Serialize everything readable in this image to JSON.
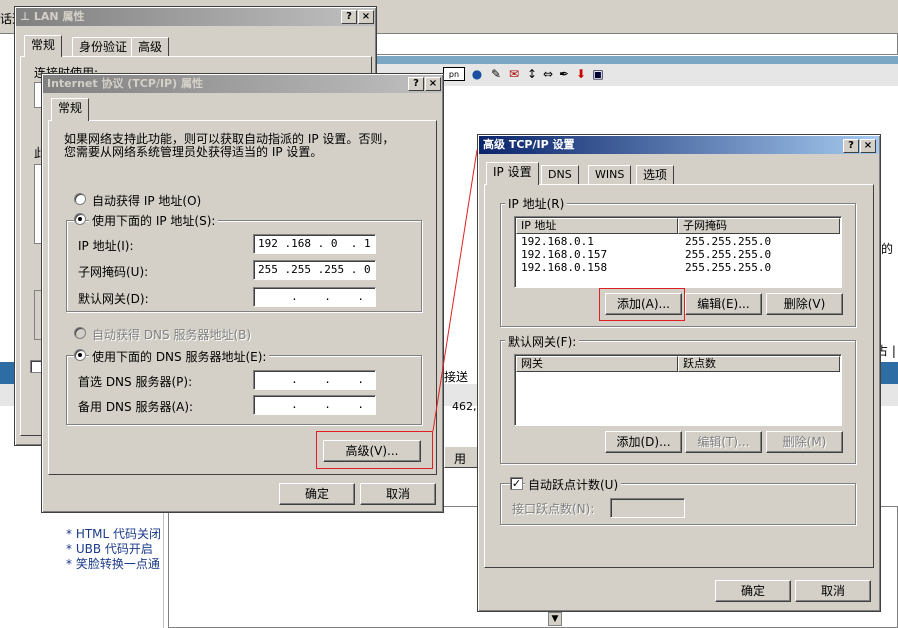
{
  "background": {
    "addr_fragment": "话追",
    "right_tail_text": "的",
    "right_tail_text2": "占 |",
    "sent_label": "接送",
    "sent_value": "462,",
    "apply_fragment": "用",
    "forum_notes": [
      "* HTML 代码关闭",
      "* UBB  代码开启",
      "* 笑脸转换一点通"
    ]
  },
  "lan_window": {
    "title": "LAN 属性",
    "help_btn": "?",
    "close_btn": "×",
    "tabs": [
      "常规",
      "身份验证",
      "高级"
    ],
    "connect_using": "连接时使用:",
    "this_conn": "此"
  },
  "tcpip_window": {
    "title": "Internet 协议 (TCP/IP) 属性",
    "help_btn": "?",
    "close_btn": "×",
    "tab": "常规",
    "desc_line1": "如果网络支持此功能，则可以获取自动指派的 IP 设置。否则，",
    "desc_line2": "您需要从网络系统管理员处获得适当的 IP 设置。",
    "auto_ip": "自动获得 IP 地址(O)",
    "use_ip": "使用下面的 IP 地址(S):",
    "ip_label": "IP 地址(I):",
    "ip_value": "192 .168 . 0  . 1",
    "mask_label": "子网掩码(U):",
    "mask_value": "255 .255 .255 . 0",
    "gateway_label": "默认网关(D):",
    "gateway_value": "     .    .    .",
    "auto_dns": "自动获得 DNS 服务器地址(B)",
    "use_dns": "使用下面的 DNS 服务器地址(E):",
    "pref_dns_label": "首选 DNS 服务器(P):",
    "pref_dns_value": "     .    .    .",
    "alt_dns_label": "备用 DNS 服务器(A):",
    "alt_dns_value": "     .    .    .",
    "advanced_btn": "高级(V)...",
    "ok_btn": "确定",
    "cancel_btn": "取消"
  },
  "advanced_window": {
    "title": "高级 TCP/IP 设置",
    "help_btn": "?",
    "close_btn": "×",
    "tabs": [
      "IP 设置",
      "DNS",
      "WINS",
      "选项"
    ],
    "ip_group": "IP 地址(R)",
    "col_ip": "IP 地址",
    "col_mask": "子网掩码",
    "rows": [
      {
        "ip": "192.168.0.1",
        "mask": "255.255.255.0"
      },
      {
        "ip": "192.168.0.157",
        "mask": "255.255.255.0"
      },
      {
        "ip": "192.168.0.158",
        "mask": "255.255.255.0"
      }
    ],
    "add_btn": "添加(A)...",
    "edit_btn": "编辑(E)...",
    "delete_btn": "删除(V)",
    "gw_group": "默认网关(F):",
    "col_gateway": "网关",
    "col_metric": "跃点数",
    "gw_add_btn": "添加(D)...",
    "gw_edit_btn": "编辑(T)...",
    "gw_delete_btn": "删除(M)",
    "auto_metric": "自动跃点计数(U)",
    "auto_metric_checked": true,
    "iface_metric_label": "接口跃点数(N):",
    "ok_btn": "确定",
    "cancel_btn": "取消"
  }
}
